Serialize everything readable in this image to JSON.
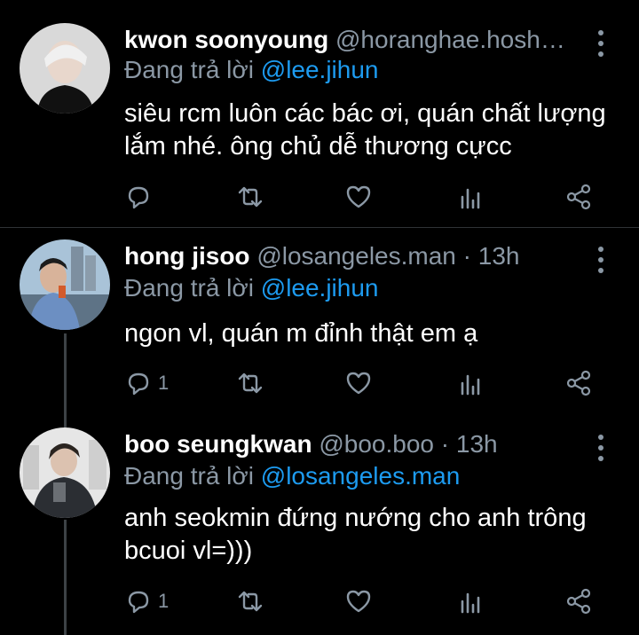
{
  "tweets": [
    {
      "name": "kwon soonyoung",
      "handle": "@horanghae.hosh…",
      "reply_label": "Đang trả lời",
      "reply_to": "@lee.jihun",
      "text": "siêu rcm luôn các bác ơi, quán chất lượng lắm nhé. ông chủ dễ thương cựcc",
      "reply_count": ""
    },
    {
      "name": "hong jisoo",
      "handle": "@losangeles.man · 13h",
      "reply_label": "Đang trả lời",
      "reply_to": "@lee.jihun",
      "text": "ngon vl, quán m đỉnh thật em ạ",
      "reply_count": "1"
    },
    {
      "name": "boo seungkwan",
      "handle": "@boo.boo · 13h",
      "reply_label": "Đang trả lời",
      "reply_to": "@losangeles.man",
      "text": "anh seokmin đứng nướng cho anh trông bcuoi vl=)))",
      "reply_count": "1"
    }
  ],
  "icons": [
    "reply-icon",
    "retweet-icon",
    "like-icon",
    "analytics-icon",
    "share-icon",
    "more-icon"
  ],
  "colors": {
    "background": "#000000",
    "secondary_text": "#8b98a5",
    "mention": "#1d9bf0",
    "divider": "#2f3336"
  }
}
